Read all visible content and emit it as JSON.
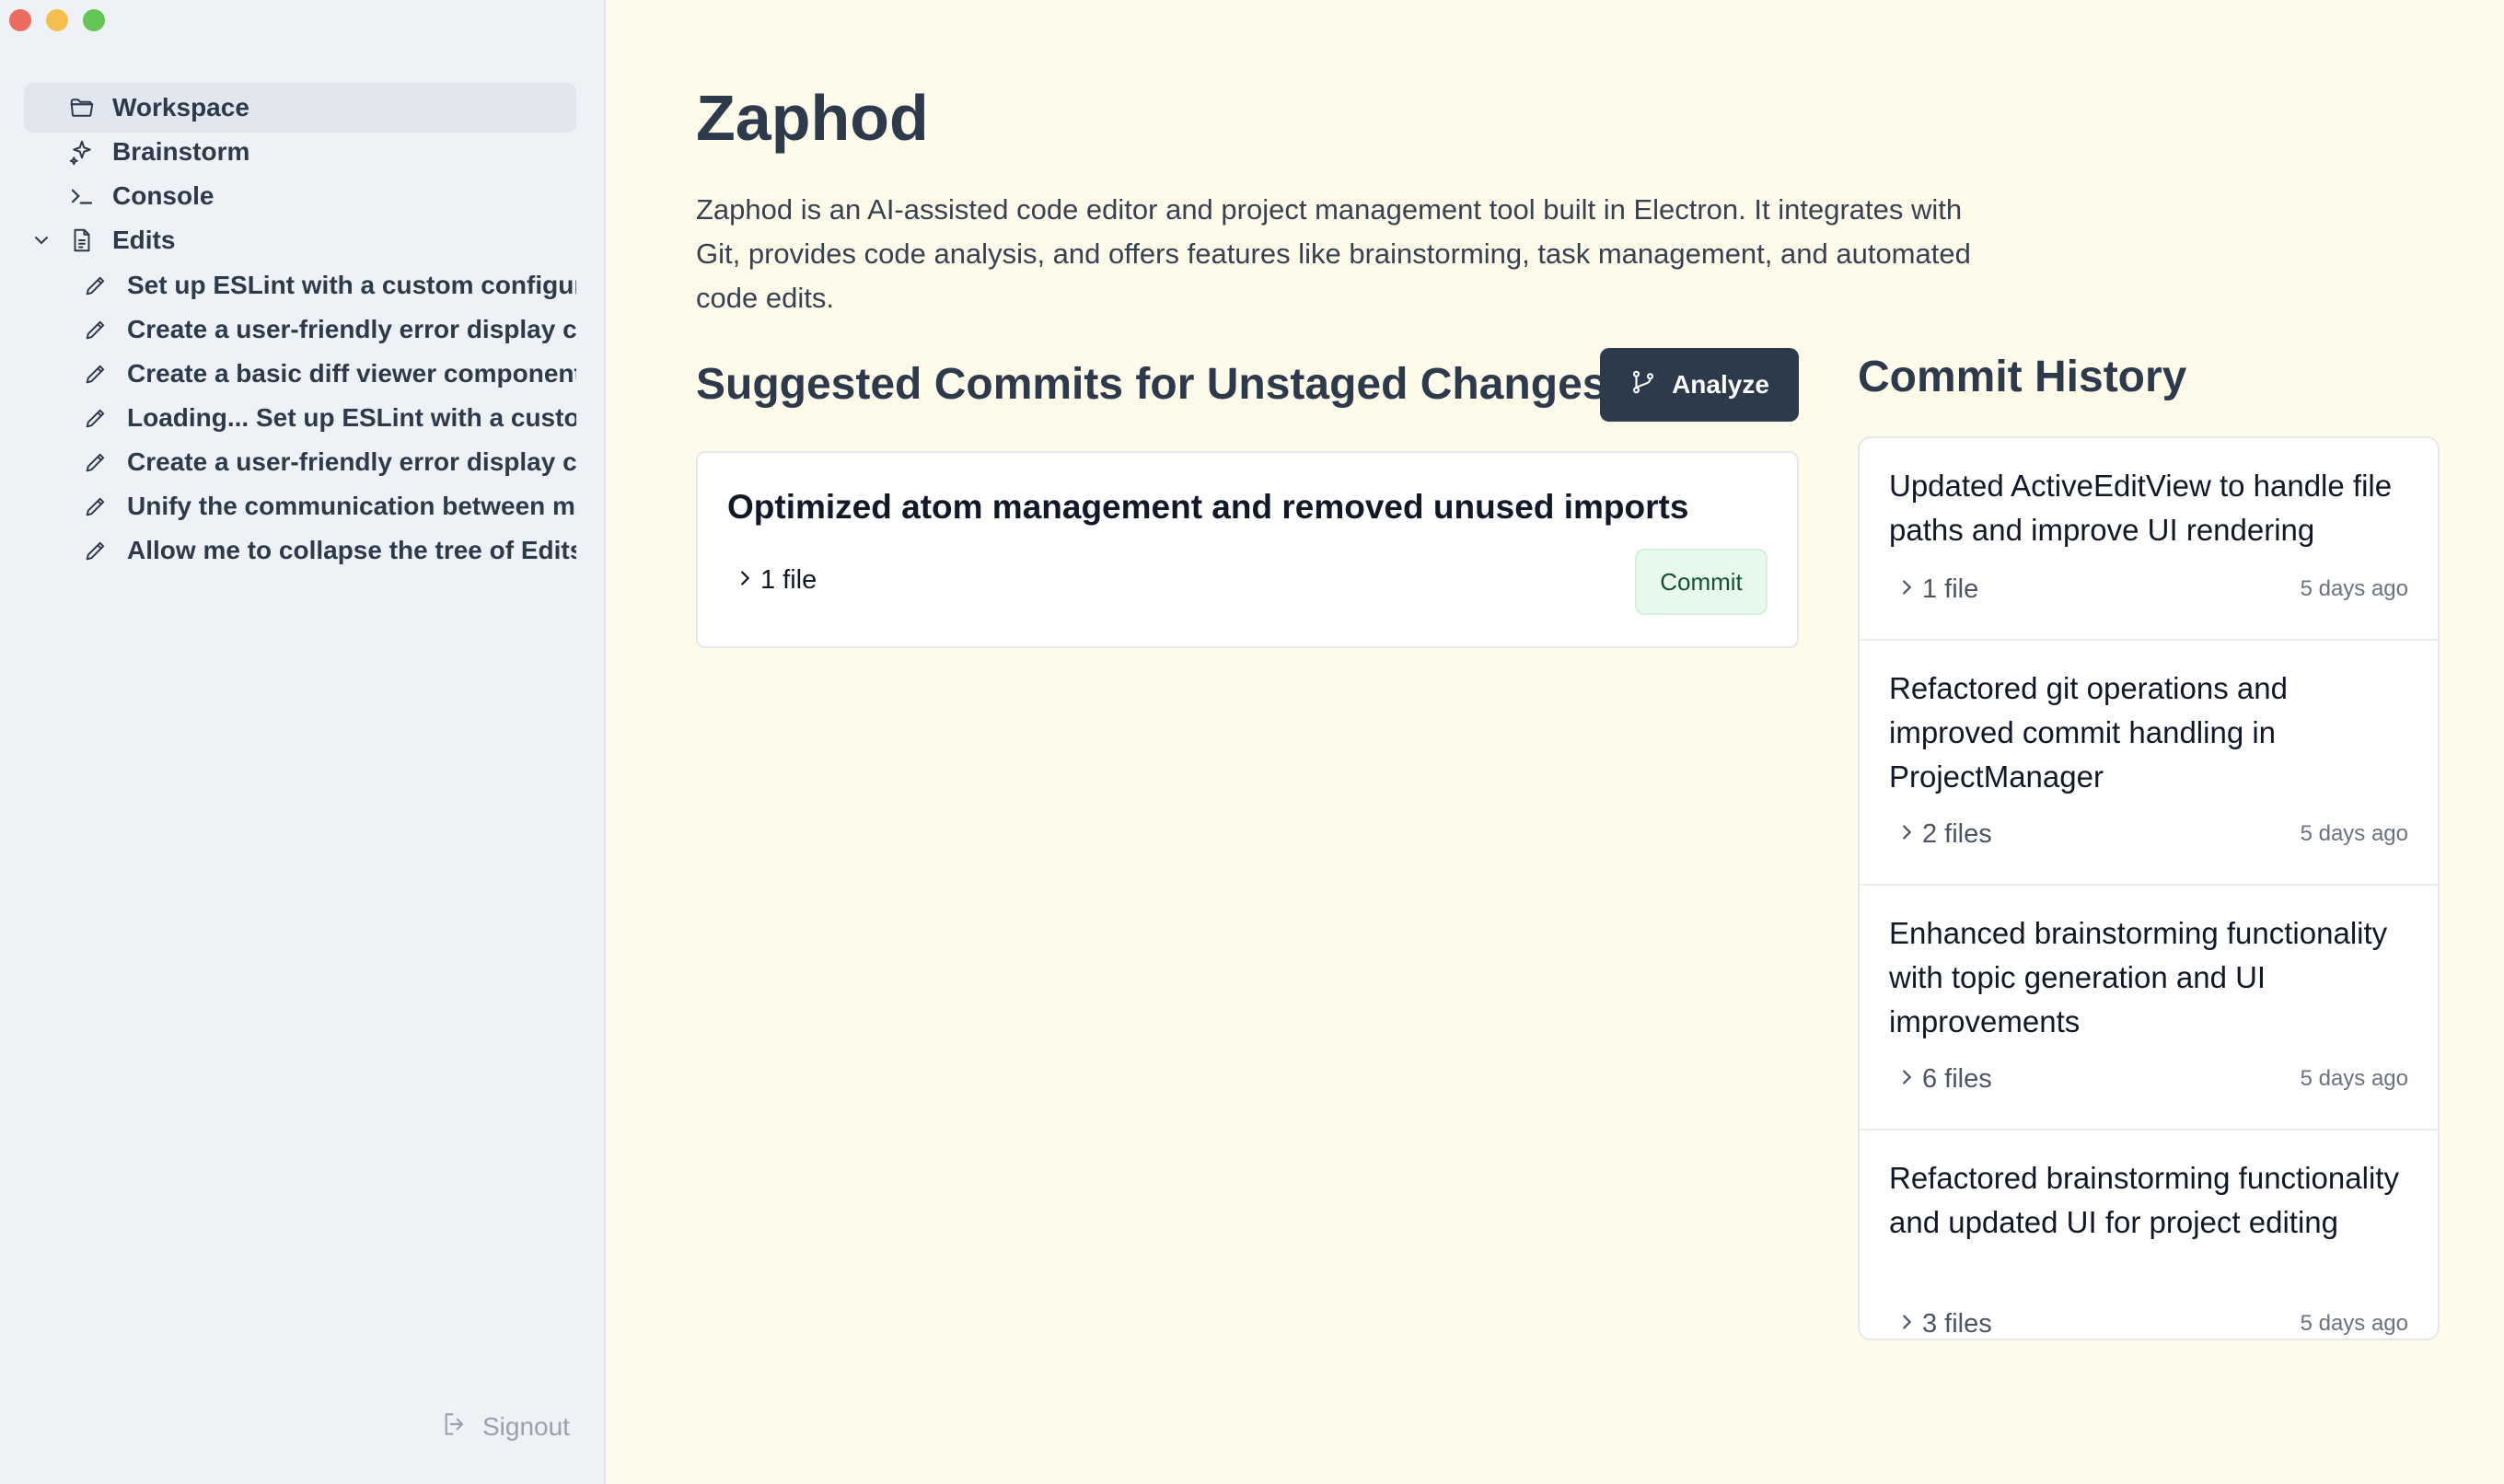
{
  "sidebar": {
    "nav": [
      {
        "label": "Workspace",
        "icon": "folder-icon"
      },
      {
        "label": "Brainstorm",
        "icon": "sparkle-icon"
      },
      {
        "label": "Console",
        "icon": "terminal-icon"
      },
      {
        "label": "Edits",
        "icon": "document-icon"
      }
    ],
    "edits": [
      "Set up ESLint with a custom configuration",
      "Create a user-friendly error display component",
      "Create a basic diff viewer component",
      "Loading... Set up ESLint with a custom configuration",
      "Create a user-friendly error display component",
      "Unify the communication between main and renderer",
      "Allow me to collapse the tree of Edits"
    ],
    "signout_label": "Signout"
  },
  "main": {
    "title": "Zaphod",
    "description": "Zaphod is an AI-assisted code editor and project management tool built in Electron. It integrates with Git, provides code analysis, and offers features like brainstorming, task management, and automated code edits.",
    "suggested": {
      "heading": "Suggested Commits for Unstaged Changes",
      "analyze_label": "Analyze",
      "commits": [
        {
          "title": "Optimized atom management and removed unused imports",
          "files": "1 file",
          "button": "Commit"
        }
      ]
    },
    "history": {
      "heading": "Commit History",
      "items": [
        {
          "title": "Updated ActiveEditView to handle file paths and improve UI rendering",
          "files": "1 file",
          "time": "5 days ago"
        },
        {
          "title": "Refactored git operations and improved commit handling in ProjectManager",
          "files": "2 files",
          "time": "5 days ago"
        },
        {
          "title": "Enhanced brainstorming functionality with topic generation and UI improvements",
          "files": "6 files",
          "time": "5 days ago"
        },
        {
          "title": "Refactored brainstorming functionality and updated UI for project editing",
          "files": "3 files",
          "time": "5 days ago"
        }
      ]
    }
  },
  "colors": {
    "sidebar_bg": "#eef2f7",
    "main_bg": "#fefbeb",
    "dark": "#2d3a4c",
    "commit_green": "#e7f8ec"
  }
}
